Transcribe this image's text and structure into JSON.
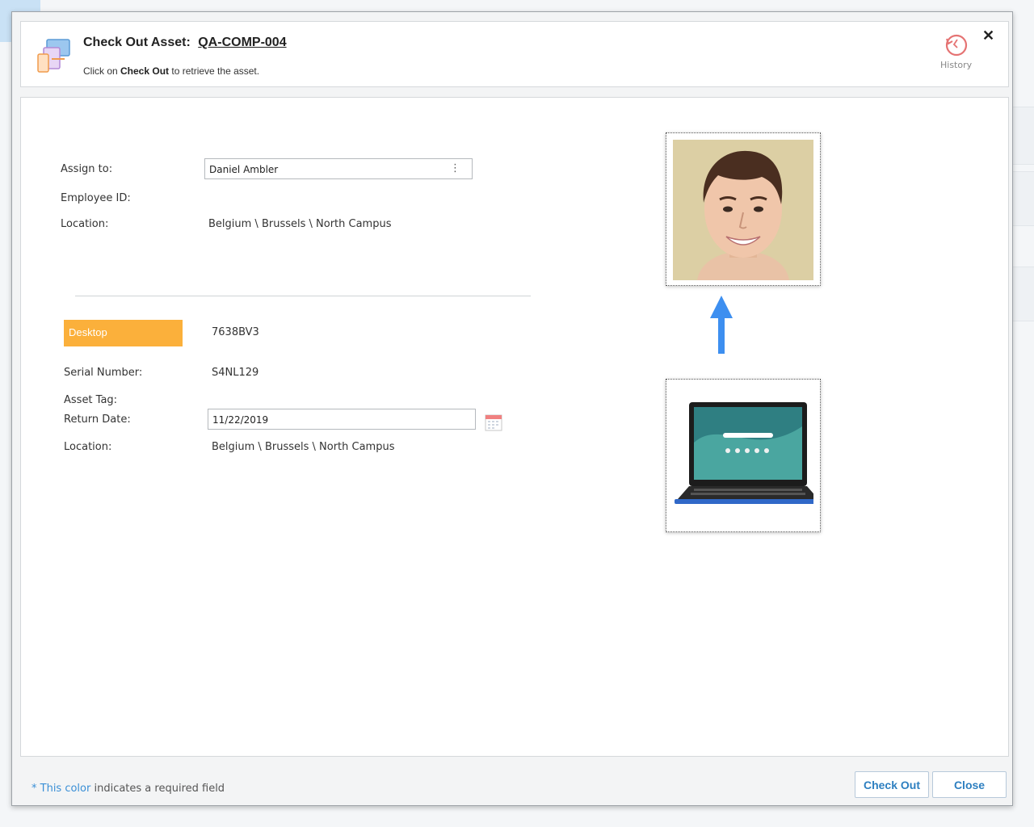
{
  "dialog": {
    "title_prefix": "Check Out Asset:",
    "asset_code": "QA-COMP-004",
    "instruction_prefix": "Click on ",
    "instruction_bold": "Check Out",
    "instruction_suffix": " to retrieve the asset.",
    "history_label": "History",
    "close_glyph": "✕"
  },
  "assignee": {
    "assign_to_label": "Assign to:",
    "assign_to_value": "Daniel Ambler",
    "employee_id_label": "Employee ID:",
    "employee_id_value": "",
    "location_label": "Location:",
    "location_value": "Belgium \\ Brussels \\ North Campus"
  },
  "asset": {
    "type_label": "Desktop",
    "type_value": "7638BV3",
    "serial_label": "Serial Number:",
    "serial_value": "S4NL129",
    "tag_label": "Asset Tag:",
    "tag_value": "",
    "return_date_label": "Return Date:",
    "return_date_value": "11/22/2019",
    "location_label": "Location:",
    "location_value": "Belgium \\ Brussels \\ North Campus"
  },
  "footer": {
    "required_marker": "* This color",
    "required_text": " indicates a required field",
    "checkout_button": "Check Out",
    "close_button": "Close"
  },
  "colors": {
    "badge": "#fbb03b",
    "accent": "#2d7fc0",
    "arrow": "#3d8ff0",
    "history": "#e57373"
  },
  "icons": {
    "asset": "devices-icon",
    "history": "history-clock-icon",
    "menu": "more-vertical-icon",
    "calendar": "calendar-icon",
    "arrow": "arrow-up-icon"
  }
}
